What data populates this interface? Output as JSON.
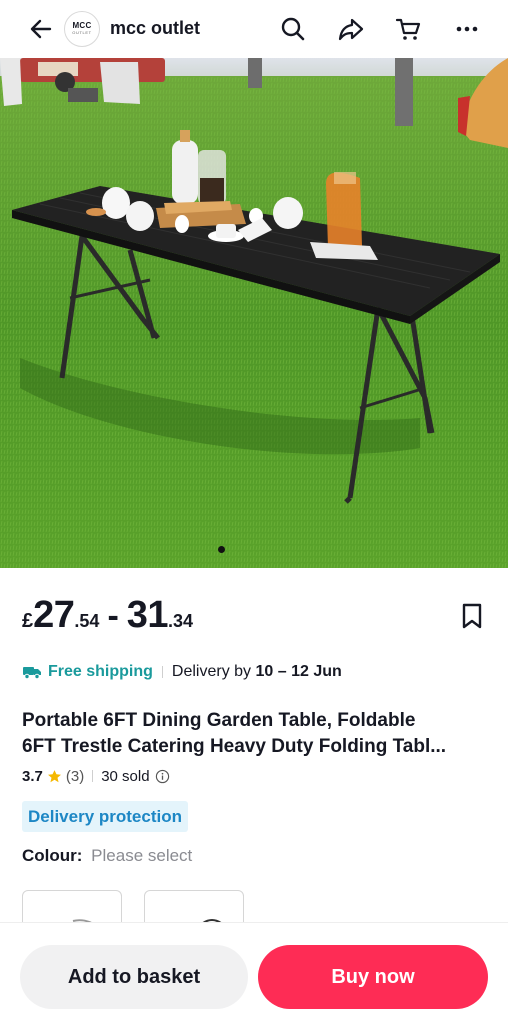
{
  "header": {
    "logo_line1": "MCC",
    "logo_line2": "OUTLET",
    "shop_name": "mcc outlet"
  },
  "gallery": {
    "current_index": 1
  },
  "price": {
    "currency": "£",
    "low_whole": "27",
    "low_fraction": ".54",
    "separator": "-",
    "high_whole": "31",
    "high_fraction": ".34"
  },
  "shipping": {
    "free_label": "Free shipping",
    "delivery_prefix": "Delivery by",
    "delivery_range": "10 – 12 Jun"
  },
  "product": {
    "title_line1": "Portable 6FT Dining Garden Table, Foldable",
    "title_line2": "6FT Trestle Catering Heavy Duty Folding Tabl..."
  },
  "rating": {
    "value": "3.7",
    "count": "(3)",
    "sold": "30 sold"
  },
  "badges": {
    "protection": "Delivery protection"
  },
  "variant": {
    "label": "Colour:",
    "value": "Please select"
  },
  "actions": {
    "add_to_basket": "Add to basket",
    "buy_now": "Buy now"
  },
  "colors": {
    "accent": "#fe2c55",
    "shipping": "#1a9a9c",
    "protection_bg": "#e4f4fb",
    "protection_text": "#1d87c5",
    "star": "#f5b800"
  },
  "icons": [
    "back-arrow-icon",
    "search-icon",
    "share-icon",
    "cart-icon",
    "more-icon",
    "bookmark-icon",
    "truck-icon",
    "star-icon",
    "info-icon"
  ]
}
